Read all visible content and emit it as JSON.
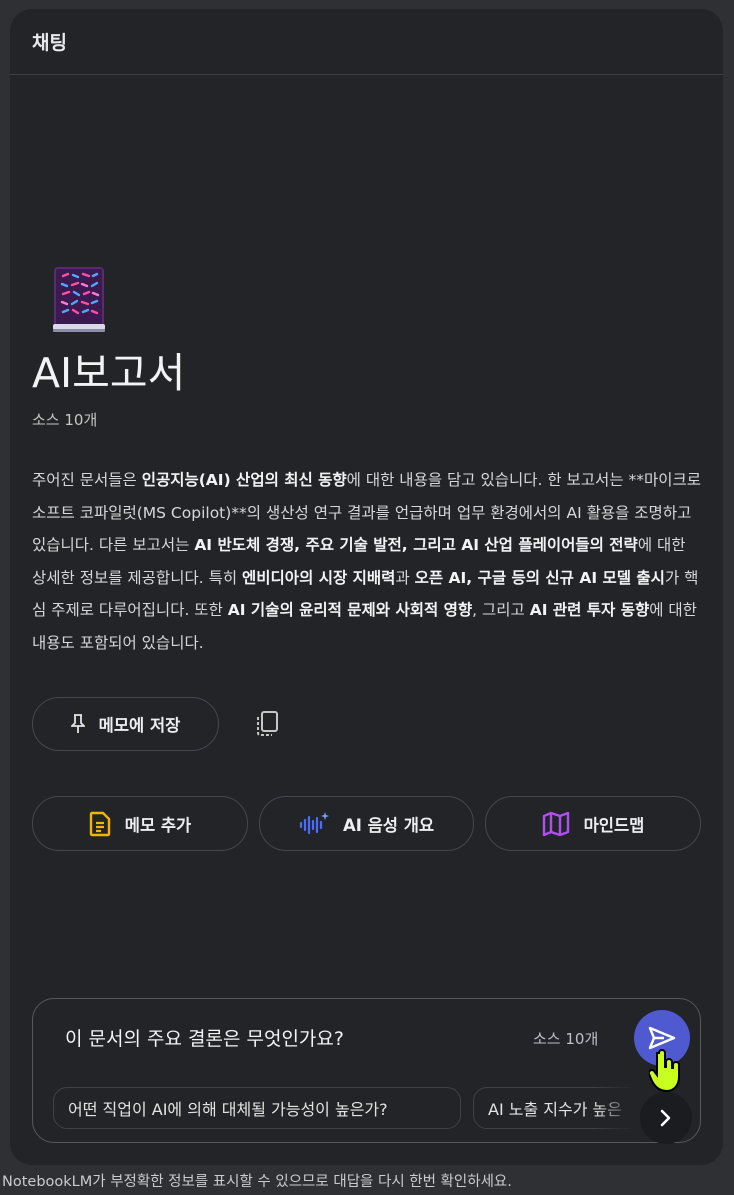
{
  "panel": {
    "title": "채팅"
  },
  "notebook": {
    "icon": "notebook-book-icon",
    "title": "AI보고서",
    "source_count": "소스 10개"
  },
  "summary": {
    "p1": "주어진 문서들은 ",
    "b1": "인공지능(AI) 산업의 최신 동향",
    "p2": "에 대한 내용을 담고 있습니다. 한 보고서는 **마이크로소프트 코파일럿(MS Copilot)**의 생산성 연구 결과를 언급하며 업무 환경에서의 AI 활용을 조명하고 있습니다. 다른 보고서는 ",
    "b2": "AI 반도체 경쟁, 주요 기술 발전, 그리고 AI 산업 플레이어들의 전략",
    "p3": "에 대한 상세한 정보를 제공합니다. 특히 ",
    "b3": "엔비디아의 시장 지배력",
    "p4": "과 ",
    "b4": "오픈 AI, 구글 등의 신규 AI 모델 출시",
    "p5": "가 핵심 주제로 다루어집니다. 또한 ",
    "b5": "AI 기술의 윤리적 문제와 사회적 영향",
    "p6": ", 그리고 ",
    "b6": "AI 관련 투자 동향",
    "p7": "에 대한 내용도 포함되어 있습니다."
  },
  "actions": {
    "save_note": "메모에 저장",
    "add_note": "메모 추가",
    "audio_overview": "AI 음성 개요",
    "mind_map": "마인드맵"
  },
  "composer": {
    "query": "이 문서의 주요 결론은 무엇인가요?",
    "source_count": "소스 10개",
    "suggestions": [
      "어떤 직업이 AI에 의해 대체될 가능성이 높은가?",
      "AI 노출 지수가 높은"
    ]
  },
  "disclaimer": "NotebookLM가 부정확한 정보를 표시할 수 있으므로 대답을 다시 한번 확인하세요.",
  "colors": {
    "background": "#2f3033",
    "panel": "#222428",
    "send_button": "#4f5ad0",
    "note_icon": "#f5b400",
    "audio_icon": "#4a6cf7",
    "mindmap_icon": "#b04ef5"
  }
}
